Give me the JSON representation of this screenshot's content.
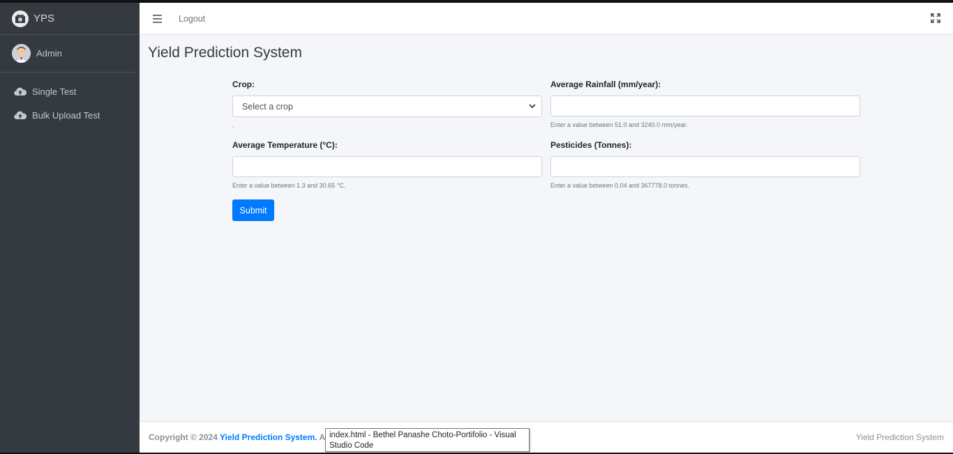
{
  "brand": {
    "name": "YPS"
  },
  "user": {
    "name": "Admin"
  },
  "sidebar": {
    "items": [
      {
        "label": "Single Test",
        "icon": "cloud-upload-icon"
      },
      {
        "label": "Bulk Upload Test",
        "icon": "cloud-upload-icon"
      }
    ]
  },
  "navbar": {
    "logout_label": "Logout"
  },
  "page": {
    "title": "Yield Prediction System"
  },
  "form": {
    "crop": {
      "label": "Crop:",
      "selected": "Select a crop",
      "help": "."
    },
    "rainfall": {
      "label": "Average Rainfall (mm/year):",
      "value": "",
      "help": "Enter a value between 51.0 and 3240.0 mm/year."
    },
    "temperature": {
      "label": "Average Temperature (°C):",
      "value": "",
      "help": "Enter a value between 1.3 and 30.65 °C."
    },
    "pesticides": {
      "label": "Pesticides (Tonnes):",
      "value": "",
      "help": "Enter a value between 0.04 and 367778.0 tonnes."
    },
    "submit_label": "Submit"
  },
  "footer": {
    "copyright": "Copyright © 2024",
    "brand_link": "Yield Prediction System.",
    "tail": "All",
    "right_text": "Yield Prediction System"
  },
  "tooltip": {
    "text": "index.html - Bethel Panashe Choto-Portifolio - Visual Studio Code"
  },
  "colors": {
    "sidebar_bg": "#343a40",
    "primary": "#007bff",
    "content_bg": "#f4f6f9"
  }
}
